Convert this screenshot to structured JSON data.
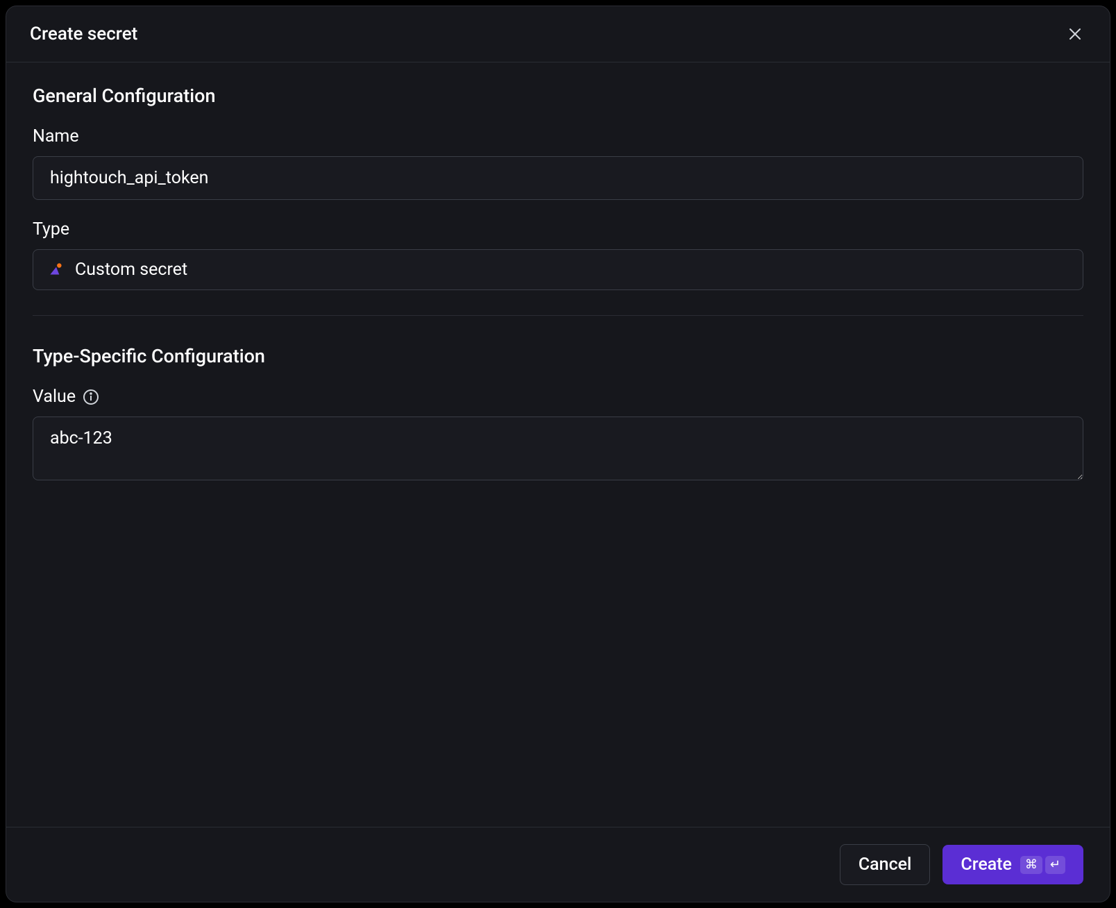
{
  "dialog": {
    "title": "Create secret"
  },
  "sections": {
    "general": {
      "title": "General Configuration",
      "name": {
        "label": "Name",
        "value": "hightouch_api_token"
      },
      "type": {
        "label": "Type",
        "selected": "Custom secret"
      }
    },
    "specific": {
      "title": "Type-Specific Configuration",
      "value": {
        "label": "Value",
        "text": "abc-123"
      }
    }
  },
  "footer": {
    "cancel": "Cancel",
    "create": "Create",
    "shortcut_cmd": "⌘",
    "shortcut_enter": "↵"
  }
}
